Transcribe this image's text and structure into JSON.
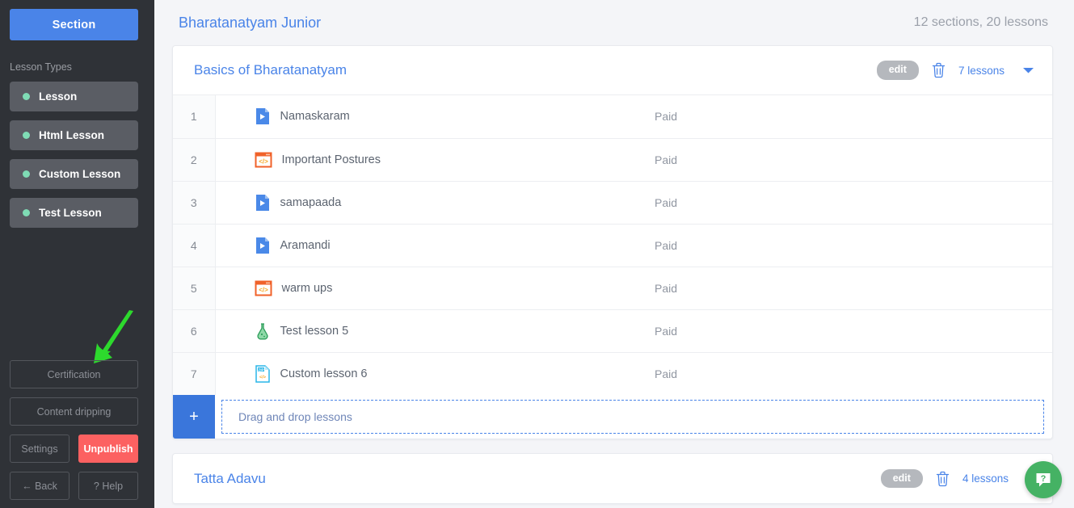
{
  "sidebar": {
    "section_button": "Section",
    "lesson_types_label": "Lesson Types",
    "lesson_types": [
      {
        "label": "Lesson",
        "dot_color": "#7fdcb5"
      },
      {
        "label": "Html Lesson",
        "dot_color": "#7fdcb5"
      },
      {
        "label": "Custom Lesson",
        "dot_color": "#7fdcb5"
      },
      {
        "label": "Test Lesson",
        "dot_color": "#7fdcb5"
      }
    ],
    "certification": "Certification",
    "content_dripping": "Content dripping",
    "settings": "Settings",
    "unpublish": "Unpublish",
    "back": "← Back",
    "help": "? Help",
    "annotation_arrow_color": "#2dd92d"
  },
  "header": {
    "title": "Bharatanatyam Junior",
    "summary": "12 sections, 20 lessons"
  },
  "sections": [
    {
      "title": "Basics of Bharatanatyam",
      "edit_label": "edit",
      "lessons_count_label": "7 lessons",
      "expanded": true,
      "caret": "chevron-down-icon",
      "lessons": [
        {
          "num": "1",
          "name": "Namaskaram",
          "icon": "video-lesson-icon",
          "access": "Paid"
        },
        {
          "num": "2",
          "name": "Important Postures",
          "icon": "html-lesson-icon",
          "access": "Paid"
        },
        {
          "num": "3",
          "name": "samapaada",
          "icon": "video-lesson-icon",
          "access": "Paid"
        },
        {
          "num": "4",
          "name": "Aramandi",
          "icon": "video-lesson-icon",
          "access": "Paid"
        },
        {
          "num": "5",
          "name": "warm ups",
          "icon": "html-lesson-icon",
          "access": "Paid"
        },
        {
          "num": "6",
          "name": "Test lesson 5",
          "icon": "test-lesson-icon",
          "access": "Paid"
        },
        {
          "num": "7",
          "name": "Custom lesson 6",
          "icon": "custom-lesson-icon",
          "access": "Paid"
        }
      ],
      "add_label": "+",
      "dropzone_label": "Drag and drop lessons"
    },
    {
      "title": "Tatta Adavu",
      "edit_label": "edit",
      "lessons_count_label": "4 lessons",
      "expanded": false,
      "caret": "chevron-right-icon"
    }
  ],
  "help_fab": {
    "icon": "chat-question-icon",
    "color": "#45b264"
  },
  "colors": {
    "accent_blue": "#4a84e8",
    "sidebar_bg": "#2f3237",
    "page_bg": "#f4f5f8",
    "danger": "#fc6161",
    "mint": "#7fdcb5"
  }
}
